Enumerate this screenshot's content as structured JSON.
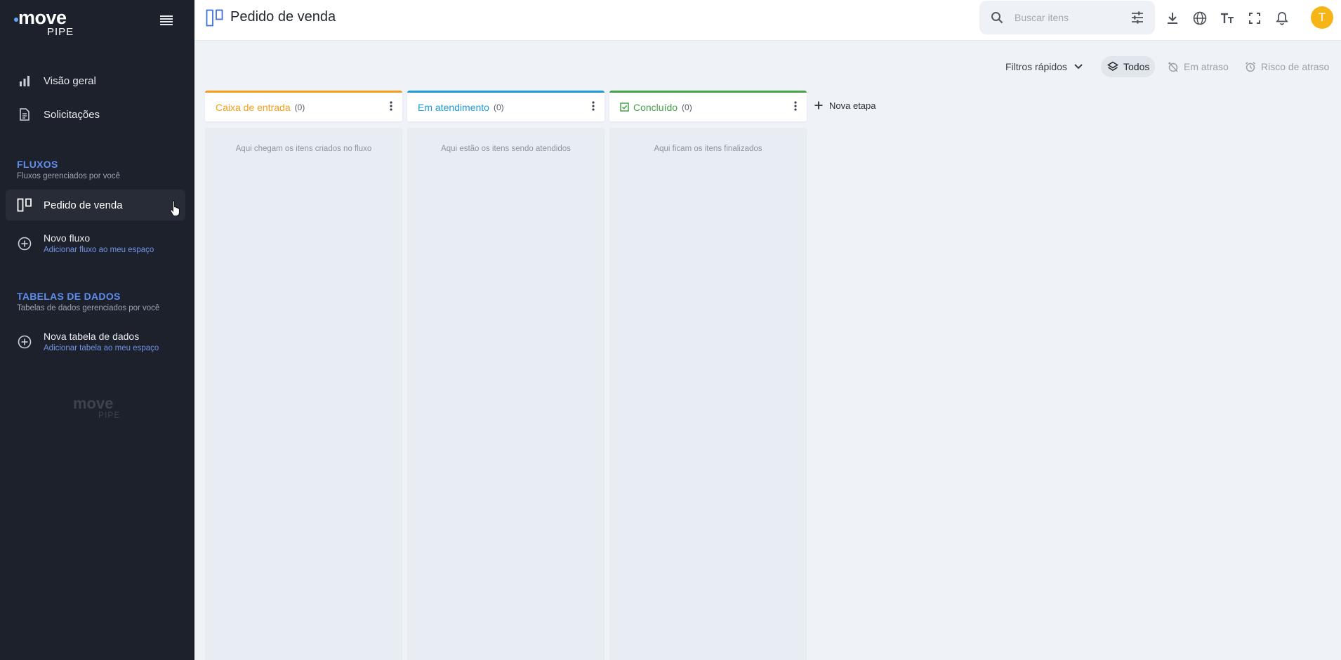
{
  "brand": {
    "name": "move",
    "sub": "PIPE"
  },
  "sidebar": {
    "nav": [
      {
        "label": "Visão geral",
        "icon": "bar-chart-icon"
      },
      {
        "label": "Solicitações",
        "icon": "document-icon"
      }
    ],
    "flows_section": {
      "title": "FLUXOS",
      "subtitle": "Fluxos gerenciados por você"
    },
    "flows": [
      {
        "label": "Pedido de venda",
        "icon": "board-icon",
        "active": true
      }
    ],
    "new_flow": {
      "title": "Novo fluxo",
      "subtitle": "Adicionar fluxo ao meu espaço"
    },
    "tables_section": {
      "title": "TABELAS DE DADOS",
      "subtitle": "Tabelas de dados gerenciados por você"
    },
    "new_table": {
      "title": "Nova tabela de dados",
      "subtitle": "Adicionar tabela ao meu espaço"
    }
  },
  "header": {
    "title": "Pedido de venda",
    "search_placeholder": "Buscar itens",
    "avatar_initial": "T",
    "icons": [
      "download-icon",
      "globe-icon",
      "text-size-icon",
      "fullscreen-icon",
      "bell-icon"
    ]
  },
  "toolbar": {
    "quick_filters": "Filtros rápidos",
    "chips": [
      {
        "label": "Todos",
        "active": true
      },
      {
        "label": "Em atraso",
        "active": false
      },
      {
        "label": "Risco de atraso",
        "active": false
      }
    ]
  },
  "columns": [
    {
      "name": "Caixa de entrada",
      "count": "(0)",
      "color": "#f29d1b",
      "empty_text": "Aqui chegam os itens criados no fluxo"
    },
    {
      "name": "Em atendimento",
      "count": "(0)",
      "color": "#1d9ad6",
      "empty_text": "Aqui estão os itens sendo atendidos"
    },
    {
      "name": "Concluído",
      "count": "(0)",
      "color": "#45a147",
      "empty_text": "Aqui ficam os itens finalizados"
    }
  ],
  "new_stage_label": "Nova etapa",
  "colors": {
    "sidebar_bg": "#1d212b",
    "accent": "#5f8df0",
    "avatar": "#f6b416"
  }
}
